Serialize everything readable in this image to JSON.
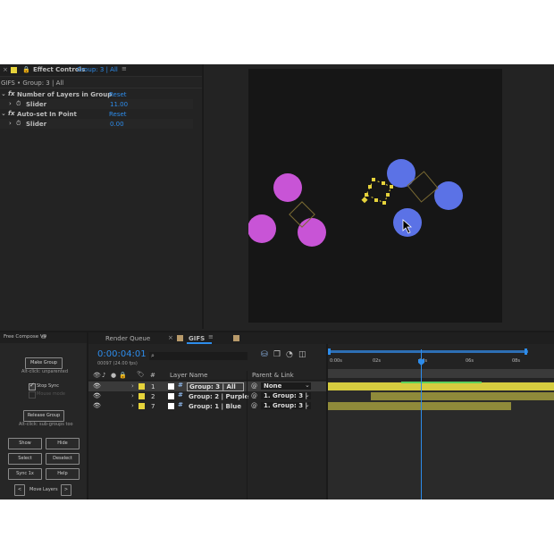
{
  "effect_controls": {
    "tab_title": "Effect Controls",
    "tab_layer": "Group: 3 |   All",
    "subtitle": "GIFS • Group: 3 |   All",
    "effects": [
      {
        "name": "Number of Layers in Group",
        "reset": "Reset",
        "param": "Slider",
        "value": "11.00"
      },
      {
        "name": "Auto-set In Point",
        "reset": "Reset",
        "param": "Slider",
        "value": "0.00"
      }
    ]
  },
  "script_panel": {
    "title": "Free Compose V9",
    "make_group": "Make Group",
    "make_group_hint": "Alt-click: unparented",
    "stop_sync": "Stop Sync",
    "mouse_mode": "Mouse mode",
    "release_group": "Release Group",
    "release_hint": "Alt-click: sub-groups too",
    "show": "Show",
    "hide": "Hide",
    "select": "Select",
    "deselect": "Deselect",
    "sync_1x": "Sync 1x",
    "help": "Help",
    "prev": "<",
    "move_layers": "Move Layers",
    "next": ">"
  },
  "timeline": {
    "tab_render": "Render Queue",
    "tab_comp": "GIFS",
    "timecode": "0:00:04:01",
    "frame_info": "00097 (24.00 fps)",
    "col_number": "#",
    "col_layer_name": "Layer Name",
    "col_parent": "Parent & Link",
    "ruler": [
      "0:00s",
      "02s",
      "04s",
      "06s",
      "08s"
    ],
    "layers": [
      {
        "num": "1",
        "name": "Group: 3 |   All",
        "parent": "None",
        "color": "#e6d33b",
        "selected": true
      },
      {
        "num": "2",
        "name": "Group: 2 |   Purple",
        "parent": "1. Group: 3 |",
        "color": "#e6d33b",
        "selected": false
      },
      {
        "num": "7",
        "name": "Group: 1 |   Blue",
        "parent": "1. Group: 3 |",
        "color": "#e6d33b",
        "selected": false
      }
    ]
  },
  "colors": {
    "accent": "#2d8ceb",
    "purple_circle": "#c854d6",
    "blue_circle": "#5b72e6",
    "label_yellow": "#e6d33b",
    "track_yellow": "#c9c23a"
  }
}
